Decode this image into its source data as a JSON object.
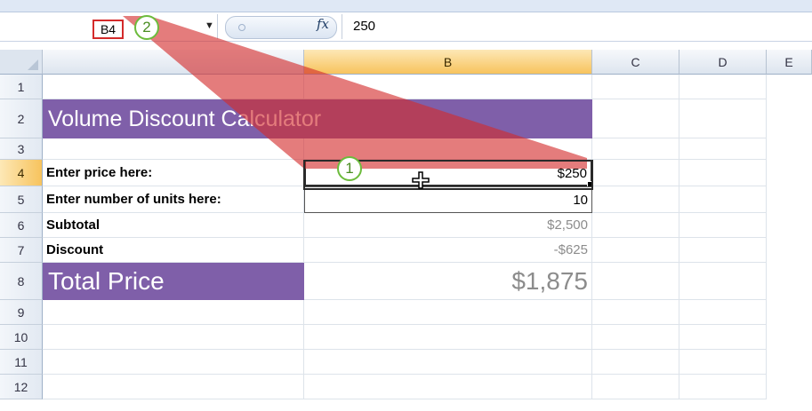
{
  "formula_bar": {
    "name_box": "B4",
    "fx": "fx",
    "formula": "250"
  },
  "callouts": {
    "one": "1",
    "two": "2"
  },
  "columns": [
    "B",
    "C",
    "D",
    "E"
  ],
  "rows": [
    "1",
    "2",
    "3",
    "4",
    "5",
    "6",
    "7",
    "8",
    "9",
    "10",
    "11",
    "12"
  ],
  "sheet": {
    "title": "Volume Discount Calculator",
    "price_label": "Enter price here:",
    "price_value": "$250",
    "units_label": "Enter number of units here:",
    "units_value": "10",
    "subtotal_label": "Subtotal",
    "subtotal_value": "$2,500",
    "discount_label": "Discount",
    "discount_value": "-$625",
    "total_label": "Total Price",
    "total_value": "$1,875"
  },
  "colors": {
    "title_band": "#7f5fa9",
    "callout_border": "#6cbb3c",
    "highlight_red": "#d42b2b",
    "selected_header": "#f7c35d"
  }
}
